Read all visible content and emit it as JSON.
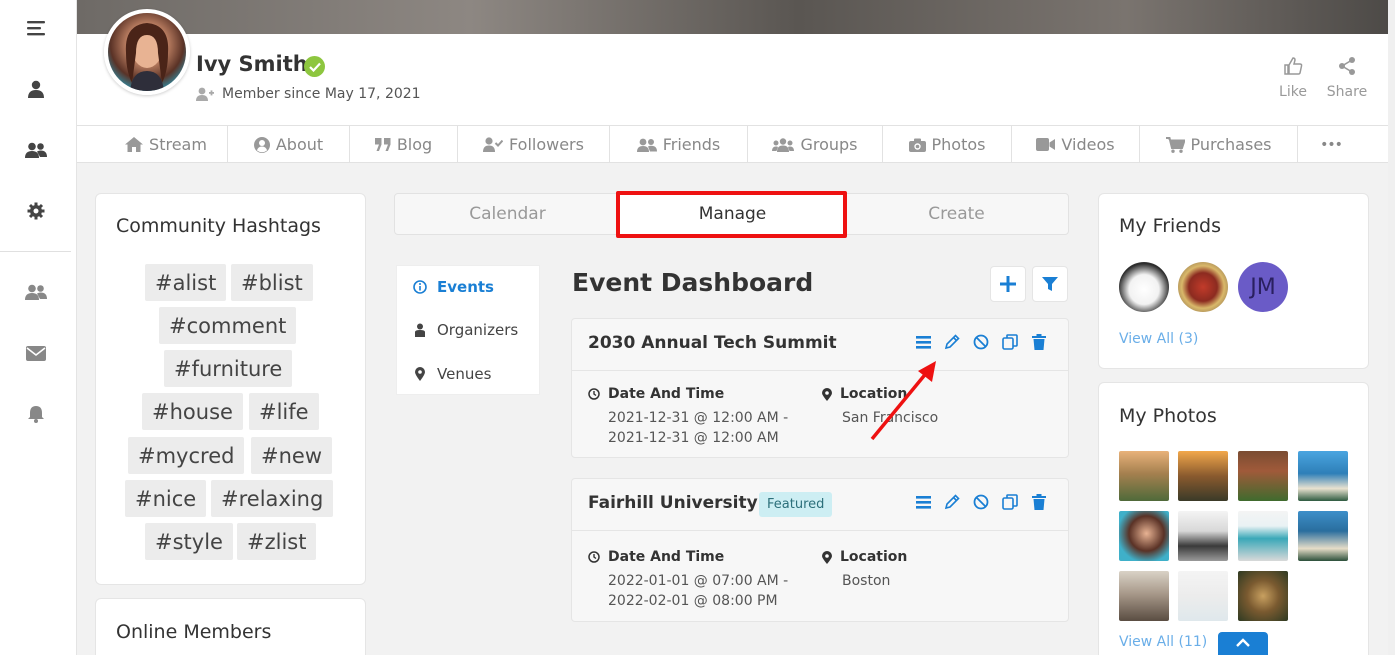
{
  "profile": {
    "name": "Ivy Smith",
    "member_since": "Member since May 17, 2021",
    "like_label": "Like",
    "share_label": "Share"
  },
  "tabs": [
    {
      "label": "Stream",
      "icon": "home-icon"
    },
    {
      "label": "About",
      "icon": "user-circle-icon"
    },
    {
      "label": "Blog",
      "icon": "quote-icon"
    },
    {
      "label": "Followers",
      "icon": "user-check-icon"
    },
    {
      "label": "Friends",
      "icon": "friends-icon"
    },
    {
      "label": "Groups",
      "icon": "groups-icon"
    },
    {
      "label": "Photos",
      "icon": "camera-icon"
    },
    {
      "label": "Videos",
      "icon": "video-icon"
    },
    {
      "label": "Purchases",
      "icon": "cart-icon"
    },
    {
      "label": "•••",
      "icon": "more-icon"
    }
  ],
  "hashtags": {
    "title": "Community Hashtags",
    "tags": [
      "#alist",
      "#blist",
      "#comment",
      "#furniture",
      "#house",
      "#life",
      "#mycred",
      "#new",
      "#nice",
      "#relaxing",
      "#style",
      "#zlist"
    ]
  },
  "online_members": {
    "title": "Online Members"
  },
  "manage_tabs": [
    "Calendar",
    "Manage",
    "Create"
  ],
  "side_menu": [
    "Events",
    "Organizers",
    "Venues"
  ],
  "dashboard": {
    "title": "Event Dashboard",
    "events": [
      {
        "name": "2030 Annual Tech Summit",
        "badge": "",
        "date_label": "Date And Time",
        "date_start": "2021-12-31 @ 12:00 AM -",
        "date_end": "2021-12-31 @ 12:00 AM",
        "location_label": "Location",
        "location": "San Francisco"
      },
      {
        "name": "Fairhill University",
        "badge": "Featured",
        "date_label": "Date And Time",
        "date_start": "2022-01-01 @ 07:00 AM -",
        "date_end": "2022-02-01 @ 08:00 PM",
        "location_label": "Location",
        "location": "Boston"
      }
    ]
  },
  "my_friends": {
    "title": "My Friends",
    "initials": "JM",
    "view_all": "View All (3)"
  },
  "my_photos": {
    "title": "My Photos",
    "view_all": "View All (11)"
  },
  "colors": {
    "accent": "#1a7fd4",
    "highlight": "#ee1111",
    "verified": "#8dc63f"
  }
}
